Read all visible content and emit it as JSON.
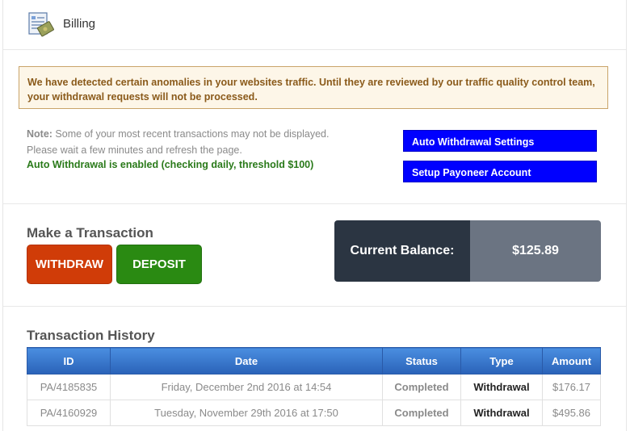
{
  "header": {
    "title": "Billing",
    "icon": "billing-icon"
  },
  "alert": {
    "text": "We have detected certain anomalies in your websites traffic. Until they are reviewed by our traffic quality control team, your withdrawal requests will not be processed."
  },
  "note": {
    "label": "Note:",
    "line1": " Some of your most recent transactions may not be displayed.",
    "line2": "Please wait a few minutes and refresh the page."
  },
  "auto_withdrawal_status": "Auto Withdrawal is enabled (checking daily, threshold $100)",
  "buttons": {
    "auto_withdrawal_settings": "Auto Withdrawal Settings",
    "setup_payoneer": "Setup Payoneer Account",
    "withdraw": "WITHDRAW",
    "deposit": "DEPOSIT"
  },
  "transaction": {
    "title": "Make a Transaction"
  },
  "balance": {
    "label": "Current Balance:",
    "value": "$125.89"
  },
  "history": {
    "title": "Transaction History",
    "columns": [
      "ID",
      "Date",
      "Status",
      "Type",
      "Amount"
    ],
    "rows": [
      {
        "id": "PA/4185835",
        "date": "Friday, December 2nd 2016 at 14:54",
        "status": "Completed",
        "type": "Withdrawal",
        "amount": "$176.17"
      },
      {
        "id": "PA/4160929",
        "date": "Tuesday, November 29th 2016 at 17:50",
        "status": "Completed",
        "type": "Withdrawal",
        "amount": "$495.86"
      }
    ]
  },
  "colors": {
    "primary_blue": "#0000ff",
    "withdraw": "#d03c08",
    "deposit": "#2a8a12",
    "balance_dark": "#2b3542",
    "balance_light": "#6b7482"
  }
}
